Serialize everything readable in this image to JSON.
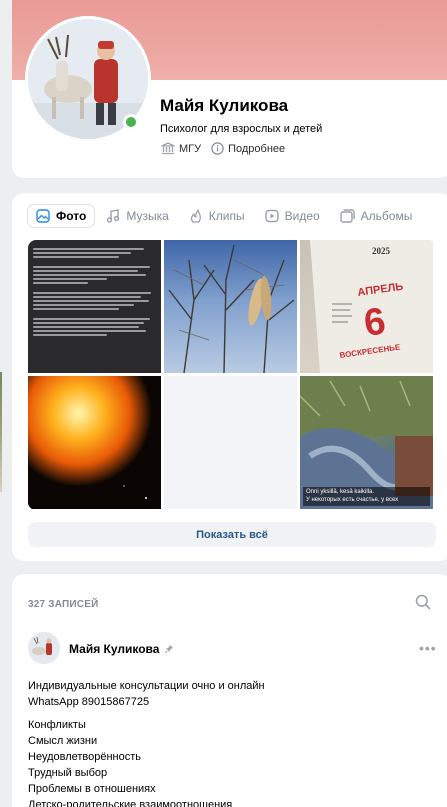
{
  "profile": {
    "name": "Майя Куликова",
    "status": "Психолог для взрослых и детей",
    "university": "МГУ",
    "more_label": "Подробнее"
  },
  "media": {
    "tabs": [
      {
        "label": "Фото",
        "icon": "photo-icon",
        "active": true
      },
      {
        "label": "Музыка",
        "icon": "music-icon",
        "active": false
      },
      {
        "label": "Клипы",
        "icon": "clips-icon",
        "active": false
      },
      {
        "label": "Видео",
        "icon": "video-icon",
        "active": false
      },
      {
        "label": "Альбомы",
        "icon": "albums-icon",
        "active": false
      }
    ],
    "calendar": {
      "year": "2025",
      "month": "АПРЕЛЬ",
      "day": "6",
      "weekday": "ВОСКРЕСЕНЬЕ"
    },
    "field_caption_line1": "Onni yksillä, kesä kaikilla.",
    "field_caption_line2": "У некоторых есть счастье, у всех",
    "show_all_label": "Показать всё"
  },
  "wall": {
    "count_label": "327 ЗАПИСЕЙ",
    "post": {
      "author": "Майя Куликова",
      "more": "•••",
      "lines_block1": [
        "Индивидуальные консультации очно и онлайн",
        "WhatsApp 89015867725"
      ],
      "lines_block2": [
        "Конфликты",
        "Смысл жизни",
        "Неудовлетворённость",
        "Трудный выбор",
        "Проблемы в отношениях",
        "Детско-родительские взаимоотношения"
      ]
    }
  },
  "colors": {
    "accent": "#2a5885",
    "online": "#4bb34b",
    "cover": "#eda6a1"
  }
}
